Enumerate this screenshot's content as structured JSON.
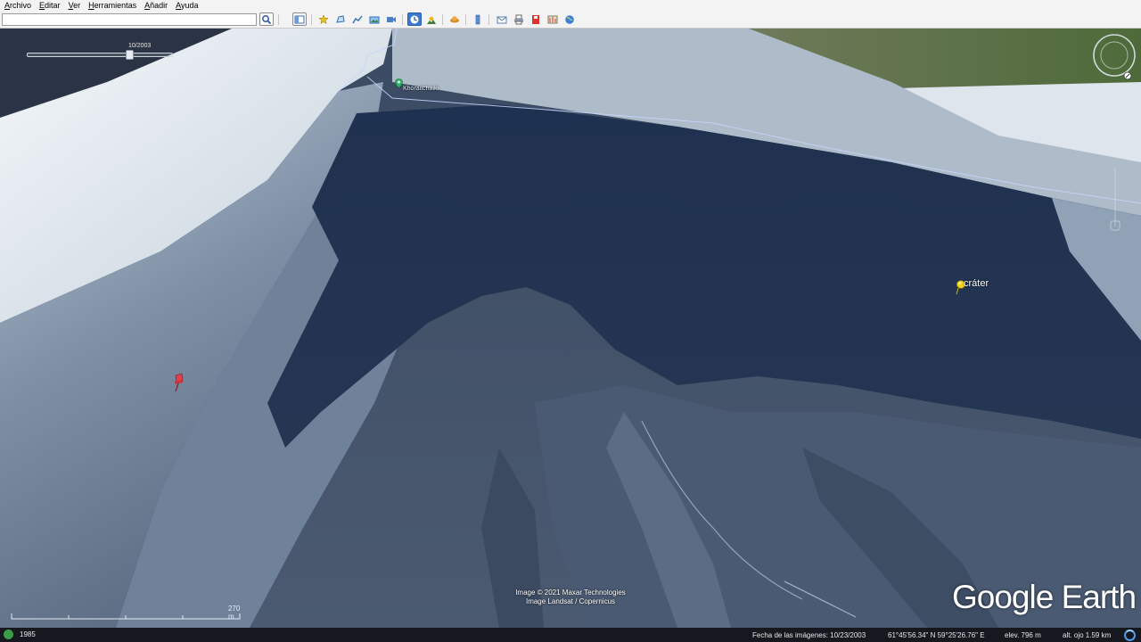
{
  "menu": [
    {
      "label": "Archivo",
      "name": "menu-archivo"
    },
    {
      "label": "Editar",
      "name": "menu-editar"
    },
    {
      "label": "Ver",
      "name": "menu-ver"
    },
    {
      "label": "Herramientas",
      "name": "menu-herramientas"
    },
    {
      "label": "Añadir",
      "name": "menu-anadir"
    },
    {
      "label": "Ayuda",
      "name": "menu-ayuda"
    }
  ],
  "search": {
    "value": "",
    "placeholder": ""
  },
  "toolbar_icons": [
    "search-icon",
    "sidebar-toggle-icon",
    "add-placemark-icon",
    "add-polygon-icon",
    "add-path-icon",
    "add-image-overlay-icon",
    "record-tour-icon",
    "historical-imagery-icon",
    "sunlight-icon",
    "switch-to-sky-icon",
    "ruler-icon",
    "email-icon",
    "print-icon",
    "save-image-icon",
    "view-in-maps-icon"
  ],
  "time_slider": {
    "date": "10/2003",
    "position": 0.71
  },
  "places": [
    {
      "name": "place-label-summit",
      "label": "Khoraitchaiki"
    },
    {
      "name": "placemark-crater",
      "label": "cráter"
    }
  ],
  "attribution": [
    "Image © 2021 Maxar Technologies",
    "Image Landsat / Copernicus"
  ],
  "brand": "Google Earth",
  "scale": {
    "label": "270 m"
  },
  "status": {
    "year": "1985",
    "imagery_date": "Fecha de las imágenes: 10/23/2003",
    "coordinates": "61°45'56.34\" N    59°25'26.76\" E",
    "elevation": "elev.   796 m",
    "eye_altitude": "alt. ojo   1.59 km"
  },
  "colors": {
    "sidebar_active": "#3a79d1",
    "placemark_yellow": "#f2d21b",
    "placemark_red": "#e0404a",
    "placemark_green": "#2fb46a",
    "boundary_line": "#c8d6ff"
  }
}
